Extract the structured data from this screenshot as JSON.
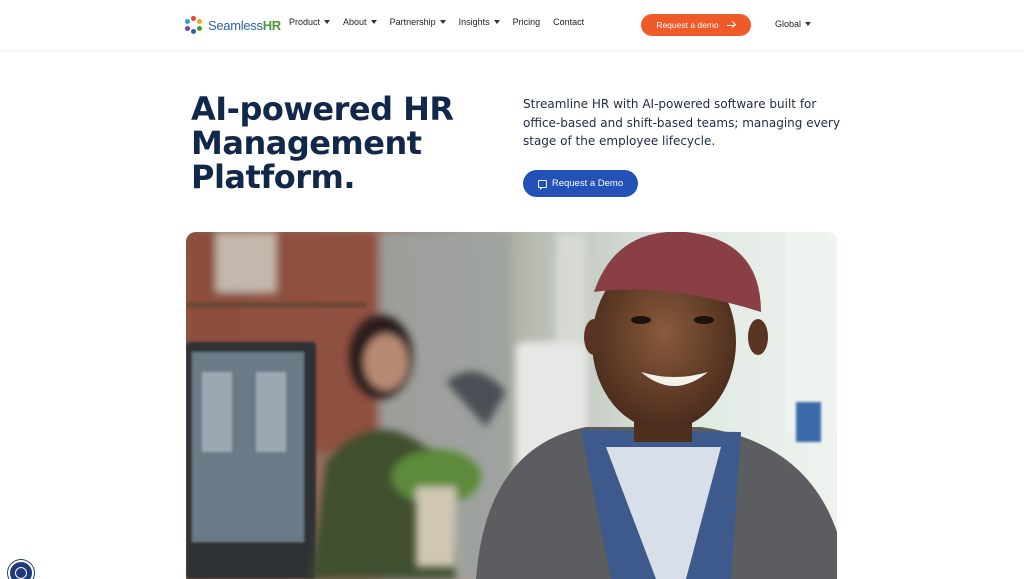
{
  "brand": {
    "name_part1": "Seamless",
    "name_part2": "HR"
  },
  "nav": {
    "items": [
      {
        "label": "Product",
        "dropdown": true
      },
      {
        "label": "About",
        "dropdown": true
      },
      {
        "label": "Partnership",
        "dropdown": true
      },
      {
        "label": "Insights",
        "dropdown": true
      },
      {
        "label": "Pricing",
        "dropdown": false
      },
      {
        "label": "Contact",
        "dropdown": false
      }
    ],
    "cta_label": "Request a demo",
    "region_label": "Global"
  },
  "hero": {
    "title": "AI-powered HR Management Platform.",
    "subtitle": "Streamline HR with AI-powered software built for office-based and shift-based teams; managing every stage of the employee lifecycle.",
    "button_label": "Request a Demo"
  },
  "colors": {
    "accent_orange": "#f05a28",
    "primary_blue": "#2451b7",
    "title_navy": "#12284a"
  },
  "icons": {
    "cta_arrow": "arrow-right-icon",
    "hero_button": "chat-icon",
    "accessibility": "accessibility-icon"
  }
}
